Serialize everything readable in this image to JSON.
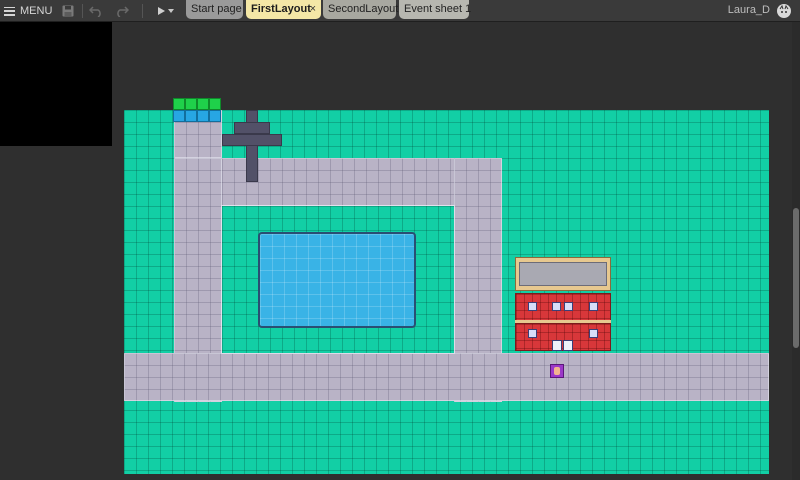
{
  "toolbar": {
    "menu_label": "MENU",
    "icons": [
      "save-icon",
      "undo-icon",
      "redo-icon",
      "play-icon",
      "chevron-down-icon"
    ]
  },
  "tabs": [
    {
      "label": "Start page",
      "active": false
    },
    {
      "label": "FirstLayout",
      "active": true,
      "close": "×"
    },
    {
      "label": "SecondLayout",
      "active": false
    },
    {
      "label": "Event sheet 1",
      "active": false
    }
  ],
  "user": {
    "name": "Laura_D",
    "icon": "user-avatar-icon"
  },
  "colors": {
    "toolbar": "#3a3a3a",
    "active_tab": "#f4e7a6",
    "grass": "#12cfa5",
    "path": "#b9b3c6",
    "water": "#39b3e6"
  }
}
